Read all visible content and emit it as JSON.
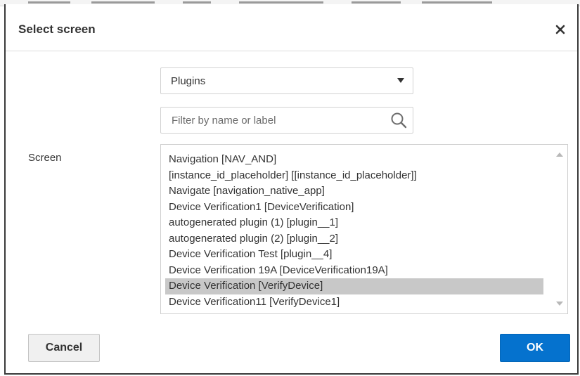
{
  "dialog": {
    "title": "Select screen",
    "close_icon": "close-icon"
  },
  "category_select": {
    "selected": "Plugins",
    "arrow_icon": "caret-down-icon"
  },
  "filter": {
    "placeholder": "Filter by name or label",
    "value": "",
    "icon": "search-icon"
  },
  "screen_field": {
    "label": "Screen",
    "items": [
      "Navigation [NAV_AND]",
      "[instance_id_placeholder] [[instance_id_placeholder]]",
      "Navigate [navigation_native_app]",
      "Device Verification1 [DeviceVerification]",
      "autogenerated plugin (1) [plugin__1]",
      "autogenerated plugin (2) [plugin__2]",
      "Device Verification Test [plugin__4]",
      "Device Verification 19A [DeviceVerification19A]",
      "Device Verification [VerifyDevice]",
      "Device Verification11 [VerifyDevice1]"
    ],
    "selected_index": 8
  },
  "footer": {
    "cancel_label": "Cancel",
    "ok_label": "OK"
  },
  "colors": {
    "primary": "#0572ce",
    "selected_row": "#c8c8c8",
    "text": "#333333"
  }
}
